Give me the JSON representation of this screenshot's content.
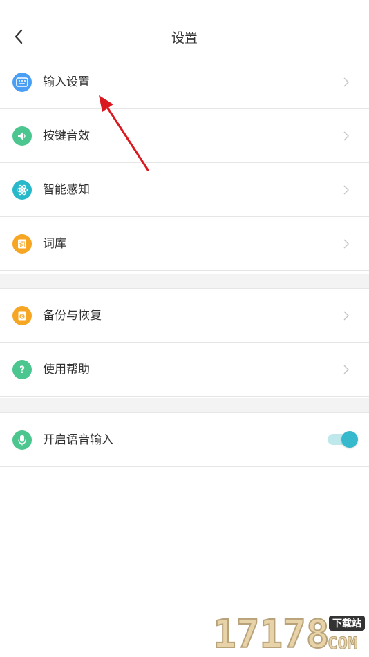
{
  "header": {
    "title": "设置",
    "back_icon": "chevron-left-icon"
  },
  "groups": [
    {
      "items": [
        {
          "label": "输入设置",
          "icon": "keyboard-icon",
          "color": "#4a9ff5"
        },
        {
          "label": "按键音效",
          "icon": "speaker-icon",
          "color": "#4cc68f"
        },
        {
          "label": "智能感知",
          "icon": "atom-icon",
          "color": "#27b8c9"
        },
        {
          "label": "词库",
          "icon": "dictionary-icon",
          "color": "#f6a623"
        }
      ]
    },
    {
      "items": [
        {
          "label": "备份与恢复",
          "icon": "backup-icon",
          "color": "#f6a623"
        },
        {
          "label": "使用帮助",
          "icon": "help-icon",
          "color": "#4cc68f"
        }
      ]
    },
    {
      "items": [
        {
          "label": "开启语音输入",
          "icon": "microphone-icon",
          "color": "#4cc68f",
          "toggle_on": true
        }
      ]
    }
  ],
  "overlay": {
    "arrow_color": "#d9191f"
  },
  "watermark": {
    "site": "17178",
    "tag": "下载站",
    "suffix": "COM"
  }
}
